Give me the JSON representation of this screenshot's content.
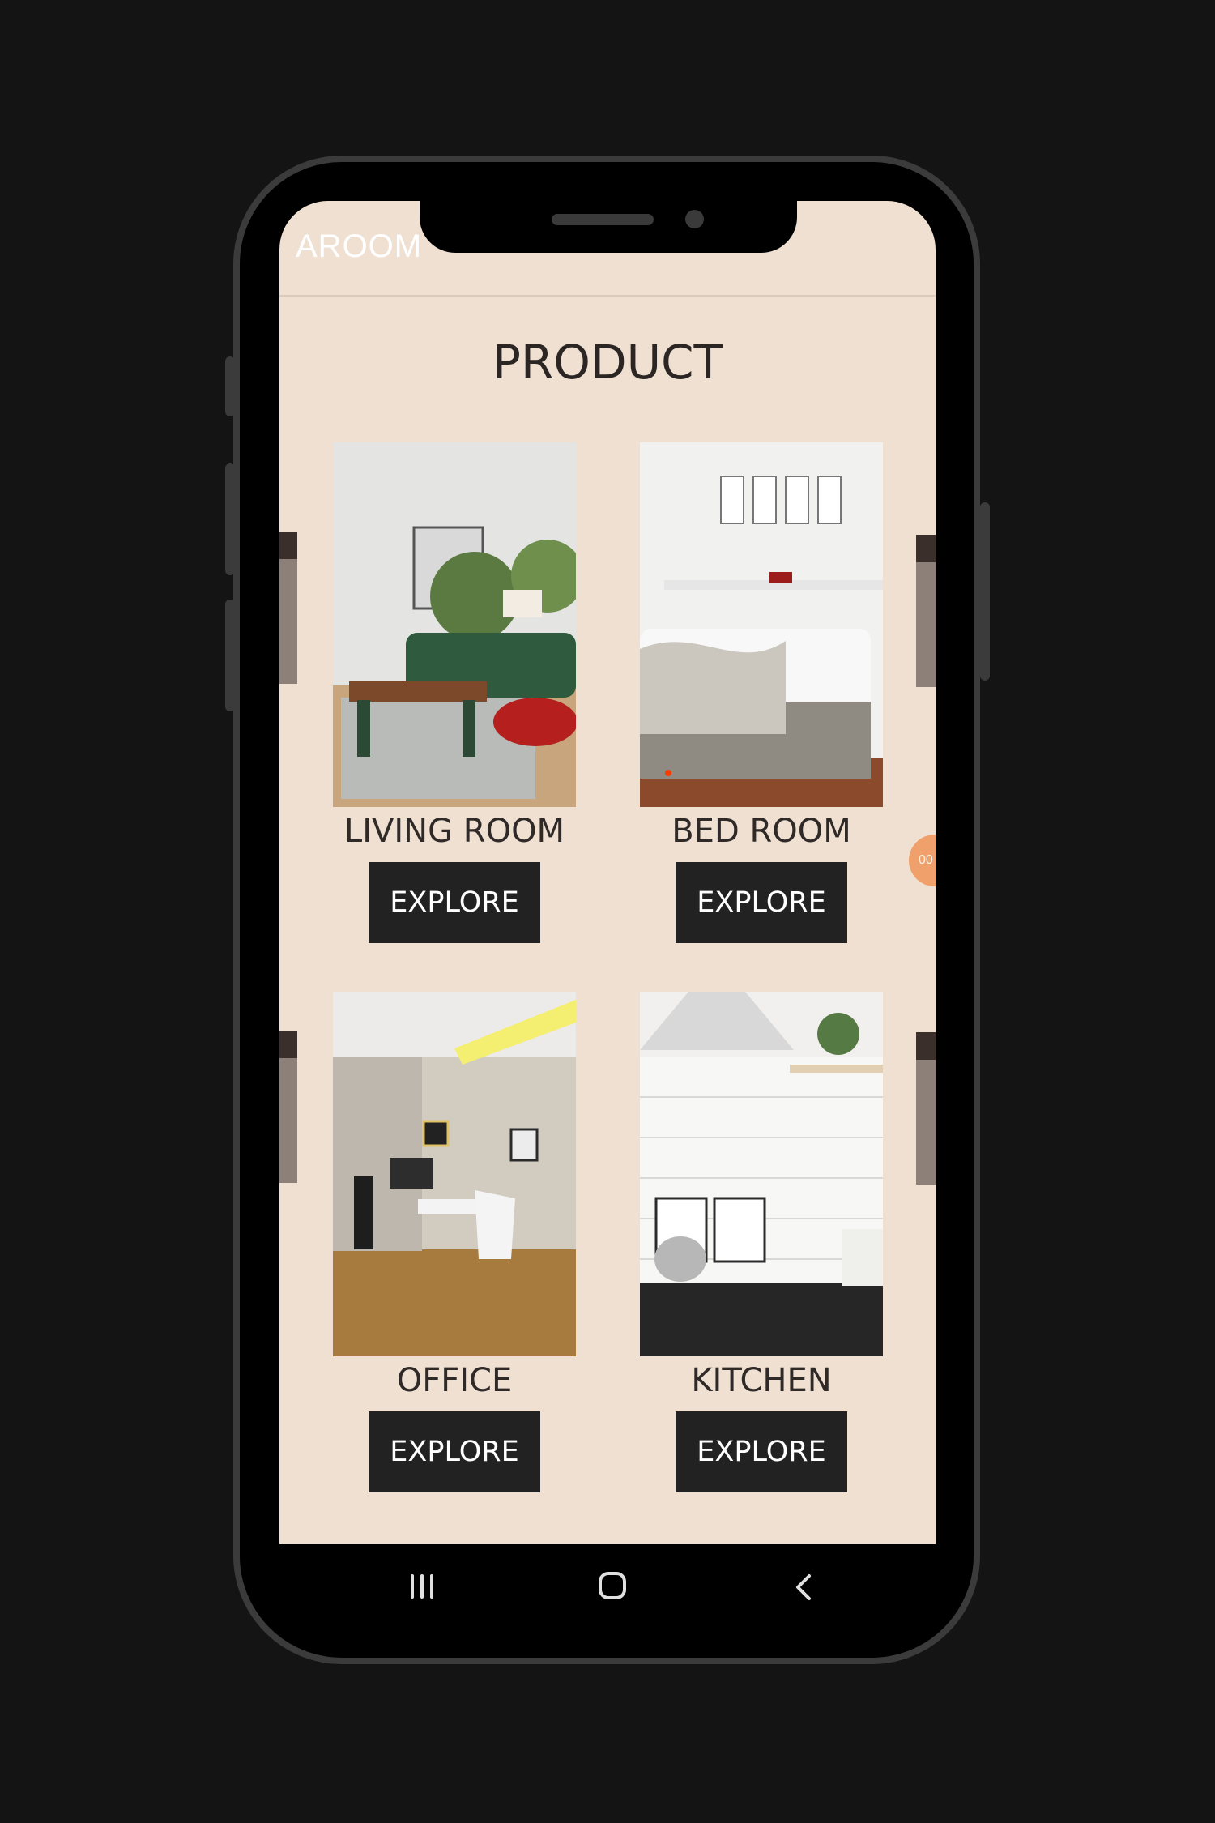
{
  "app": {
    "brand_text": "AROOM"
  },
  "page": {
    "title": "PRODUCT"
  },
  "products": [
    {
      "label": "LIVING ROOM",
      "button": "EXPLORE"
    },
    {
      "label": "BED ROOM",
      "button": "EXPLORE"
    },
    {
      "label": "OFFICE",
      "button": "EXPLORE"
    },
    {
      "label": "KITCHEN",
      "button": "EXPLORE"
    }
  ],
  "floating_badge": {
    "text": "00"
  },
  "navigation": {
    "icons": [
      "recent-apps-icon",
      "home-icon",
      "back-icon"
    ]
  },
  "colors": {
    "screen_bg": "#efe0d2",
    "button_bg": "#222222",
    "device_bg": "#141414",
    "accent": "#f0a06a"
  }
}
